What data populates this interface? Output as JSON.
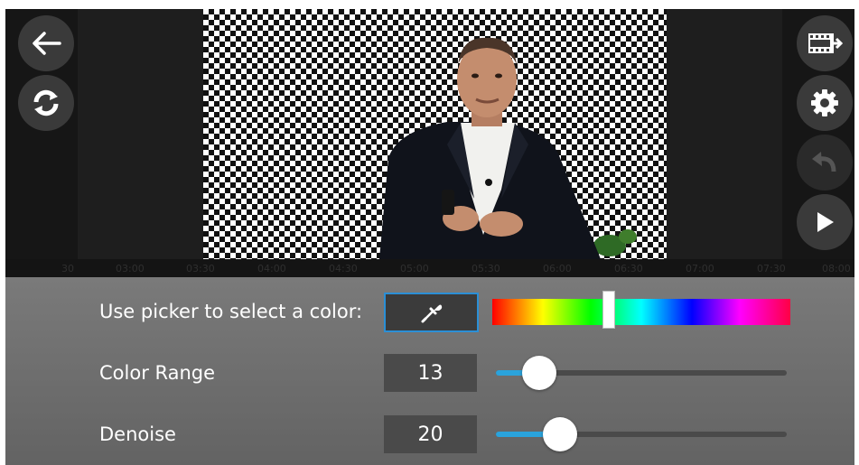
{
  "timeline": {
    "ticks": [
      "30",
      "03:00",
      "03:30",
      "04:00",
      "04:30",
      "05:00",
      "05:30",
      "06:00",
      "06:30",
      "07:00",
      "07:30",
      "08:00"
    ]
  },
  "toolbar_left": {
    "back_icon": "arrow-left-icon",
    "refresh_icon": "refresh-icon"
  },
  "toolbar_right": {
    "export_icon": "film-export-icon",
    "settings_icon": "gear-icon",
    "undo_icon": "undo-icon",
    "play_icon": "play-icon"
  },
  "controls": {
    "picker": {
      "label": "Use picker to select a color:",
      "icon": "eyedropper-icon",
      "hue_value": 0.39
    },
    "color_range": {
      "label": "Color Range",
      "value": "13",
      "slider_fraction": 0.15
    },
    "denoise": {
      "label": "Denoise",
      "value": "20",
      "slider_fraction": 0.22
    }
  },
  "colors": {
    "accent": "#2aa3dc",
    "picker_border": "#2b8fd6",
    "panel_bg": "#6e6e6e",
    "button_bg": "#3a3a3a"
  }
}
